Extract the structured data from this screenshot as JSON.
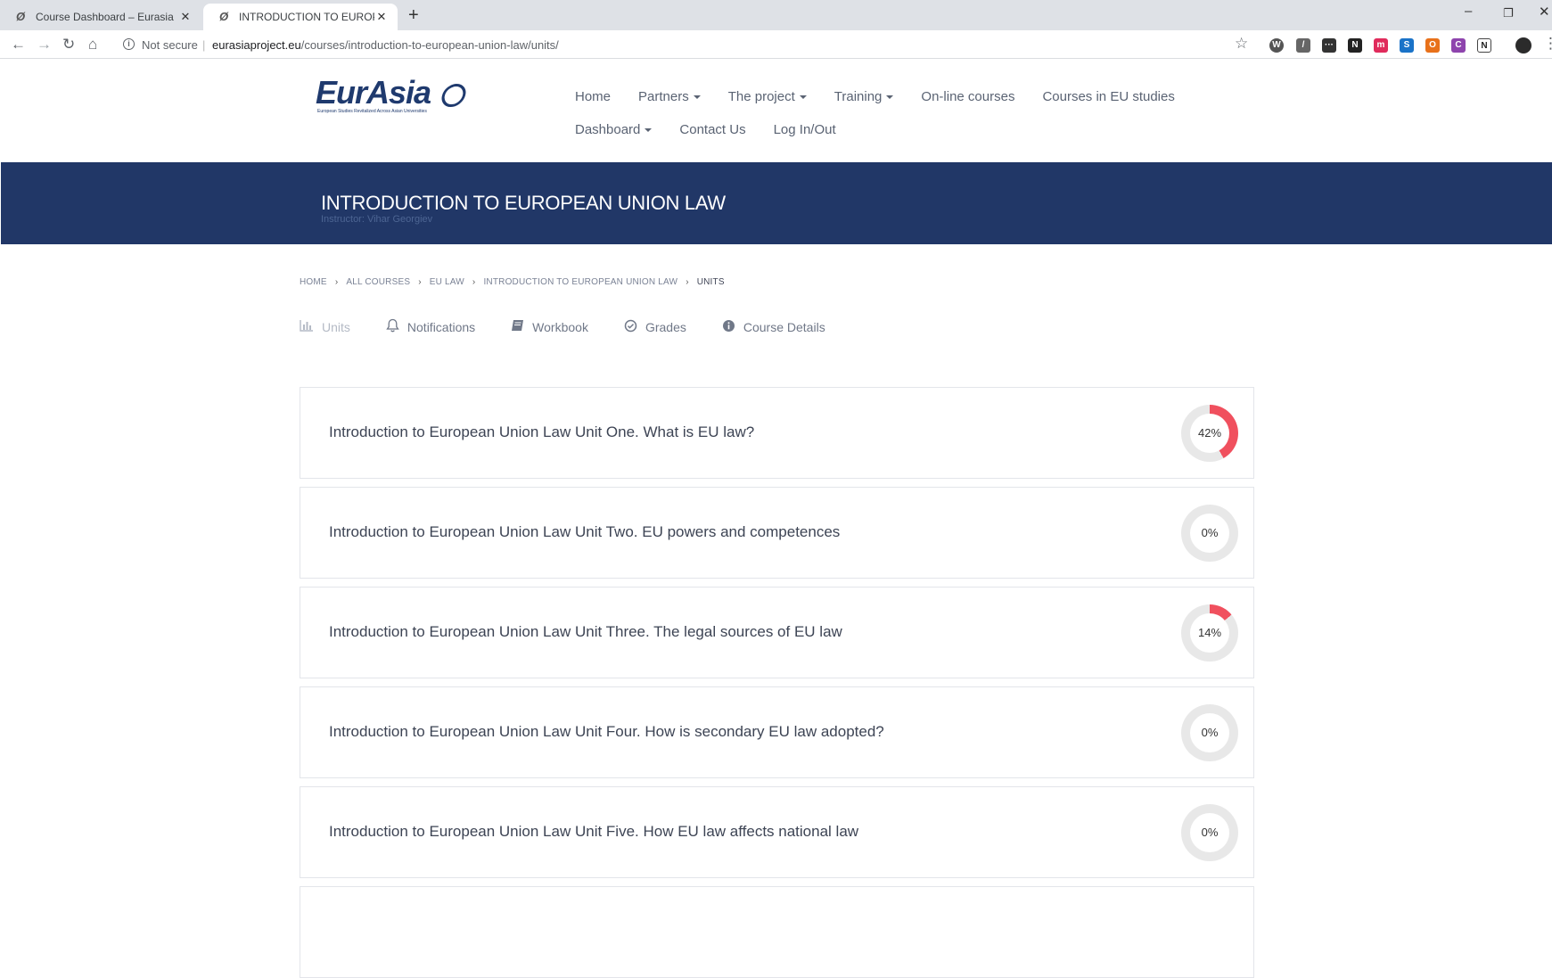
{
  "browser": {
    "tabs": [
      {
        "title": "Course Dashboard – Eurasia",
        "active": false
      },
      {
        "title": "INTRODUCTION TO EUROPEAN",
        "active": true
      }
    ],
    "security_label": "Not secure",
    "url_host": "eurasiaproject.eu",
    "url_path": "/courses/introduction-to-european-union-law/units/"
  },
  "site": {
    "logo_text": "EurAsia",
    "logo_tagline": "European Studies Revitalized Across Asian Universities",
    "nav_row1": [
      {
        "label": "Home",
        "dropdown": false
      },
      {
        "label": "Partners",
        "dropdown": true
      },
      {
        "label": "The project",
        "dropdown": true
      },
      {
        "label": "Training",
        "dropdown": true
      },
      {
        "label": "On-line courses",
        "dropdown": false
      },
      {
        "label": "Courses in EU studies",
        "dropdown": false
      }
    ],
    "nav_row2": [
      {
        "label": "Dashboard",
        "dropdown": true
      },
      {
        "label": "Contact Us",
        "dropdown": false
      },
      {
        "label": "Log In/Out",
        "dropdown": false
      }
    ]
  },
  "banner": {
    "title": "INTRODUCTION TO EUROPEAN UNION LAW",
    "instructor": "Instructor:  Vihar Georgiev"
  },
  "breadcrumb": [
    "HOME",
    "ALL COURSES",
    "EU LAW",
    "INTRODUCTION TO EUROPEAN UNION LAW",
    "UNITS"
  ],
  "course_tabs": [
    {
      "label": "Units",
      "icon": "bar-chart-icon"
    },
    {
      "label": "Notifications",
      "icon": "bell-icon"
    },
    {
      "label": "Workbook",
      "icon": "book-icon"
    },
    {
      "label": "Grades",
      "icon": "check-circle-icon"
    },
    {
      "label": "Course Details",
      "icon": "info-circle-icon"
    }
  ],
  "units": [
    {
      "title": "Introduction to European Union Law Unit One. What is EU law?",
      "progress_label": "42%",
      "progress": 0.42
    },
    {
      "title": "Introduction to European Union Law Unit Two. EU powers and competences",
      "progress_label": "0%",
      "progress": 0
    },
    {
      "title": "Introduction to European Union Law Unit Three. The legal sources of EU law",
      "progress_label": "14%",
      "progress": 0.14
    },
    {
      "title": "Introduction to European Union Law Unit Four. How is secondary EU law adopted?",
      "progress_label": "0%",
      "progress": 0
    },
    {
      "title": "Introduction to European Union Law Unit Five. How EU law affects national law",
      "progress_label": "0%",
      "progress": 0
    }
  ],
  "colors": {
    "banner_bg": "#213767",
    "progress_fill": "#f0505e",
    "progress_track": "#e8e8e8",
    "logo": "#1f3a6e"
  }
}
